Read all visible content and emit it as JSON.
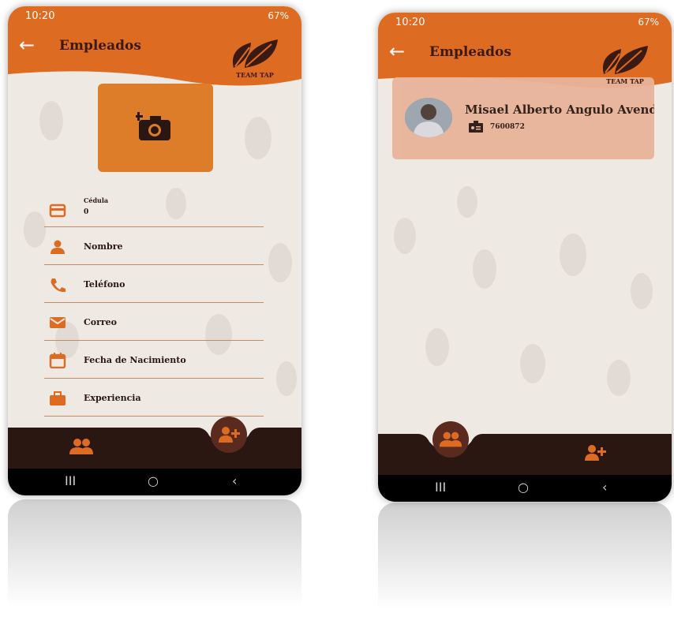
{
  "status_bar": {
    "time": "10:20",
    "battery_left": "67%",
    "battery_right": "67%"
  },
  "header": {
    "title": "Empleados",
    "logo_text": "TEAM TAP"
  },
  "form": {
    "fields": [
      {
        "label": "Cédula",
        "value": "0",
        "icon": "id-card-icon"
      },
      {
        "label": "Nombre",
        "icon": "person-icon"
      },
      {
        "label": "Teléfono",
        "icon": "phone-icon"
      },
      {
        "label": "Correo",
        "icon": "email-icon"
      },
      {
        "label": "Fecha de Nacimiento",
        "icon": "calendar-icon"
      },
      {
        "label": "Experiencia",
        "icon": "briefcase-icon"
      }
    ]
  },
  "employee_card": {
    "name": "Misael Alberto Angulo Avend",
    "id": "7600872"
  },
  "colors": {
    "primary": "#dd6b22",
    "dark": "#2b1712",
    "background": "#efe9e4",
    "card": "#e7b49a"
  }
}
